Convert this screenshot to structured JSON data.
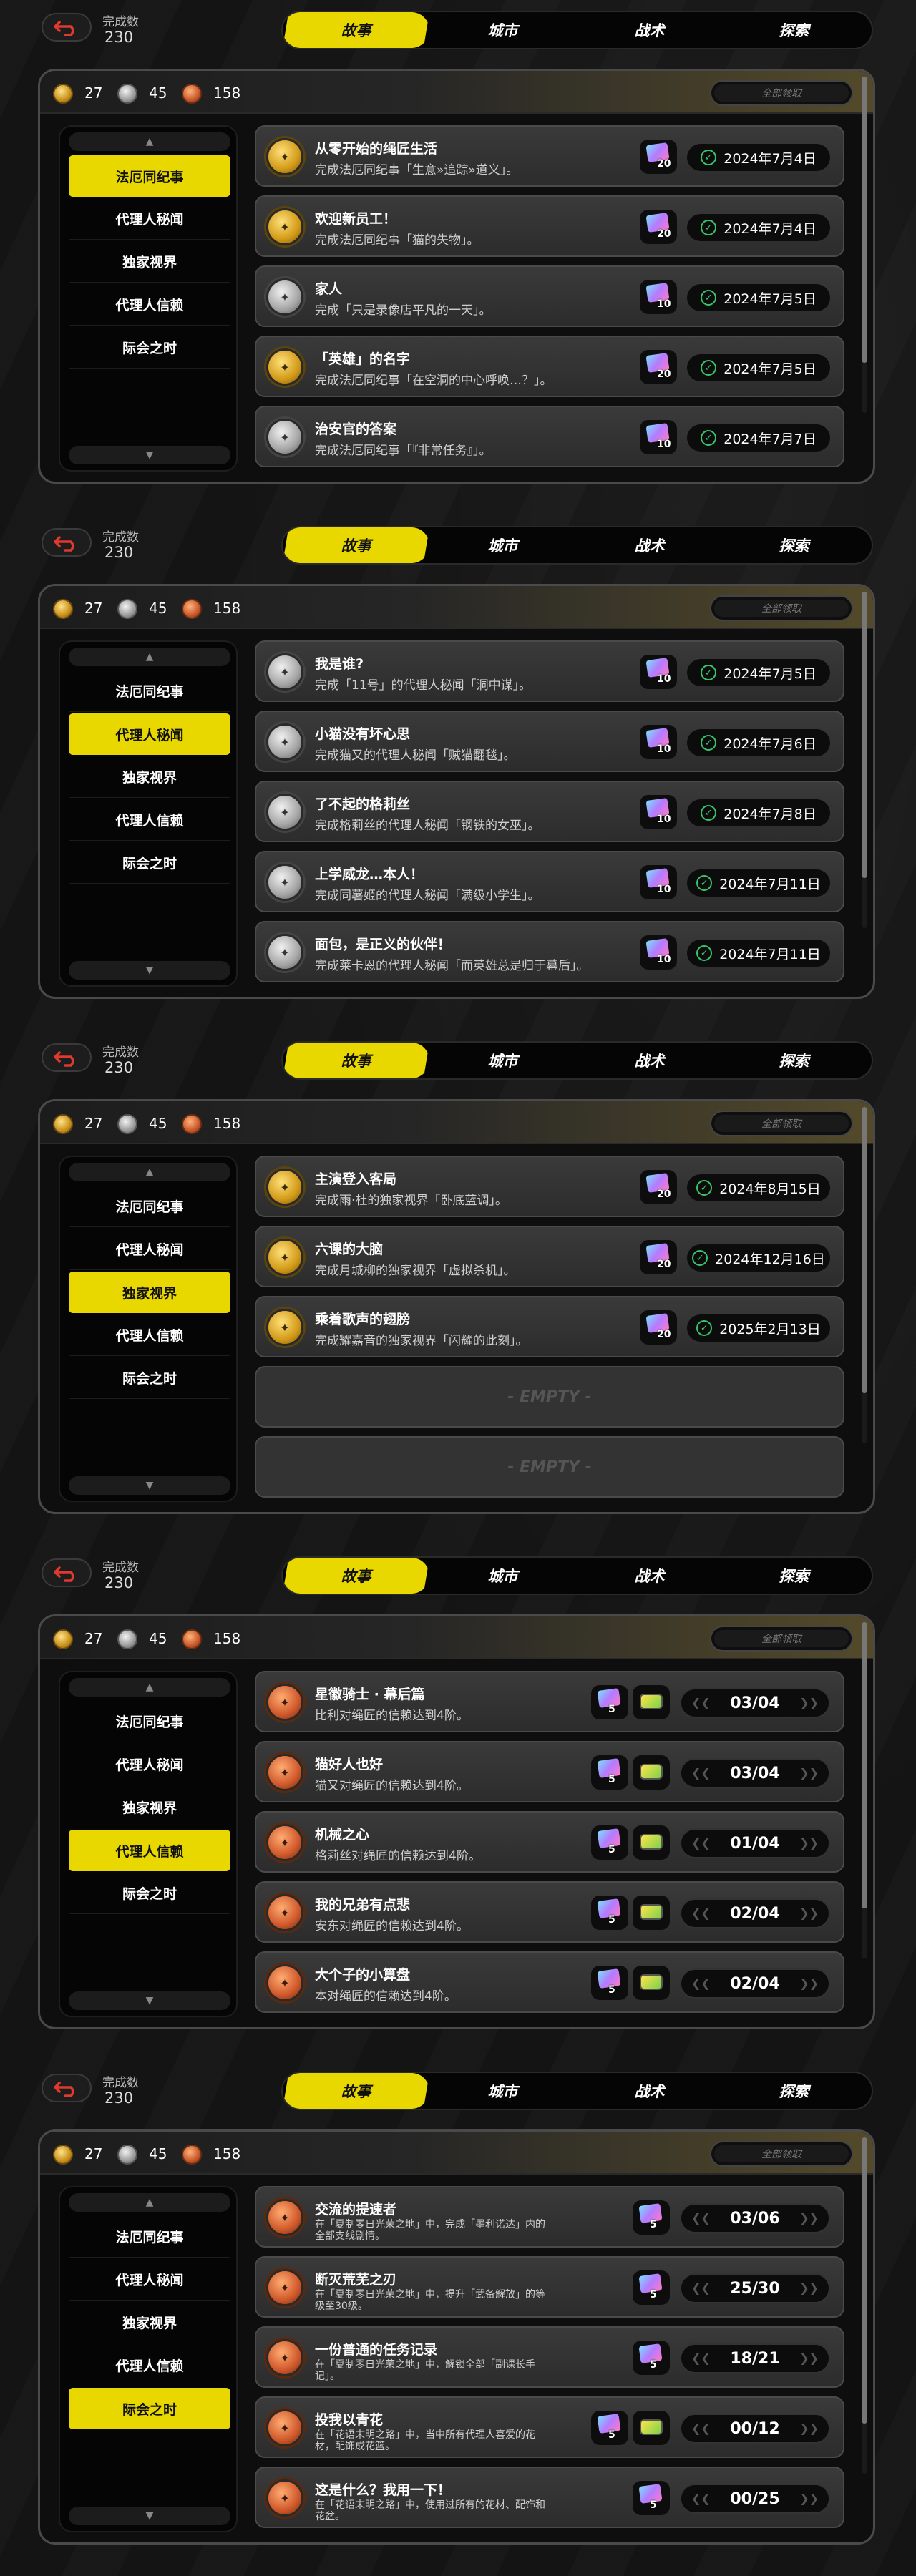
{
  "completion": {
    "label": "完成数",
    "value": "230"
  },
  "tabs": [
    "故事",
    "城市",
    "战术",
    "探索"
  ],
  "currency": {
    "gold": "27",
    "silver": "45",
    "bronze": "158"
  },
  "claim_all": "全部领取",
  "sidebar": [
    "法厄同纪事",
    "代理人秘闻",
    "独家视界",
    "代理人信赖",
    "际会之时"
  ],
  "empty_label": "- EMPTY -",
  "sections": [
    {
      "active_sidebar": 0,
      "items": [
        {
          "medal": "gold",
          "title": "从零开始的绳匠生活",
          "desc": "完成法厄同纪事「生意»追踪»道义」。",
          "reward": "20",
          "status": "date",
          "date": "2024年7月4日"
        },
        {
          "medal": "gold",
          "title": "欢迎新员工！",
          "desc": "完成法厄同纪事「猫的失物」。",
          "reward": "20",
          "status": "date",
          "date": "2024年7月4日"
        },
        {
          "medal": "silver",
          "title": "家人",
          "desc": "完成「只是录像店平凡的一天」。",
          "reward": "10",
          "status": "date",
          "date": "2024年7月5日"
        },
        {
          "medal": "gold",
          "title": "「英雄」的名字",
          "desc": "完成法厄同纪事「在空洞的中心呼唤…？」。",
          "reward": "20",
          "status": "date",
          "date": "2024年7月5日"
        },
        {
          "medal": "silver",
          "title": "治安官的答案",
          "desc": "完成法厄同纪事「『非常任务』」。",
          "reward": "10",
          "status": "date",
          "date": "2024年7月7日"
        }
      ]
    },
    {
      "active_sidebar": 1,
      "items": [
        {
          "medal": "silver",
          "title": "我是谁?",
          "desc": "完成「11号」的代理人秘闻「洞中谋」。",
          "reward": "10",
          "status": "date",
          "date": "2024年7月5日"
        },
        {
          "medal": "silver",
          "title": "小猫没有坏心思",
          "desc": "完成猫又的代理人秘闻「贼猫翻毯」。",
          "reward": "10",
          "status": "date",
          "date": "2024年7月6日"
        },
        {
          "medal": "silver",
          "title": "了不起的格莉丝",
          "desc": "完成格莉丝的代理人秘闻「钢铁的女巫」。",
          "reward": "10",
          "status": "date",
          "date": "2024年7月8日"
        },
        {
          "medal": "silver",
          "title": "上学威龙…本人！",
          "desc": "完成同薯姬的代理人秘闻「满级小学生」。",
          "reward": "10",
          "status": "date",
          "date": "2024年7月11日"
        },
        {
          "medal": "silver",
          "title": "面包，是正义的伙伴！",
          "desc": "完成莱卡恩的代理人秘闻「而英雄总是归于幕后」。",
          "reward": "10",
          "status": "date",
          "date": "2024年7月11日"
        }
      ]
    },
    {
      "active_sidebar": 2,
      "items": [
        {
          "medal": "gold",
          "title": "主演登入客局",
          "desc": "完成雨·杜的独家视界「卧底蓝调」。",
          "reward": "20",
          "status": "date",
          "date": "2024年8月15日"
        },
        {
          "medal": "gold",
          "title": "六课的大脑",
          "desc": "完成月城柳的独家视界「虚拟杀机」。",
          "reward": "20",
          "status": "date",
          "date": "2024年12月16日"
        },
        {
          "medal": "gold",
          "title": "乘着歌声的翅膀",
          "desc": "完成耀嘉音的独家视界「闪耀的此刻」。",
          "reward": "20",
          "status": "date",
          "date": "2025年2月13日"
        },
        {
          "empty": true
        },
        {
          "empty": true
        }
      ]
    },
    {
      "active_sidebar": 3,
      "items": [
        {
          "medal": "bronze",
          "title": "星徽骑士 · 幕后篇",
          "desc": "比利对绳匠的信赖达到4阶。",
          "reward": "5",
          "extra": true,
          "status": "progress",
          "progress": "03/04"
        },
        {
          "medal": "bronze",
          "title": "猫好人也好",
          "desc": "猫又对绳匠的信赖达到4阶。",
          "reward": "5",
          "extra": true,
          "status": "progress",
          "progress": "03/04"
        },
        {
          "medal": "bronze",
          "title": "机械之心",
          "desc": "格莉丝对绳匠的信赖达到4阶。",
          "reward": "5",
          "extra": true,
          "status": "progress",
          "progress": "01/04"
        },
        {
          "medal": "bronze",
          "title": "我的兄弟有点悲",
          "desc": "安东对绳匠的信赖达到4阶。",
          "reward": "5",
          "extra": true,
          "status": "progress",
          "progress": "02/04"
        },
        {
          "medal": "bronze",
          "title": "大个子的小算盘",
          "desc": "本对绳匠的信赖达到4阶。",
          "reward": "5",
          "extra": true,
          "status": "progress",
          "progress": "02/04"
        }
      ]
    },
    {
      "active_sidebar": 4,
      "items": [
        {
          "medal": "bronze",
          "title": "交流的提速者",
          "desc": "在「夏制零日光荣之地」中，完成「墨利诺达」内的全部支线剧情。",
          "small": true,
          "reward": "5",
          "status": "progress",
          "progress": "03/06"
        },
        {
          "medal": "bronze",
          "title": "断灭荒芜之刃",
          "desc": "在「夏制零日光荣之地」中，提升「武备解放」的等级至30级。",
          "small": true,
          "reward": "5",
          "status": "progress",
          "progress": "25/30"
        },
        {
          "medal": "bronze",
          "title": "一份普通的任务记录",
          "desc": "在「夏制零日光荣之地」中，解锁全部「副课长手记」。",
          "small": true,
          "reward": "5",
          "status": "progress",
          "progress": "18/21"
        },
        {
          "medal": "bronze",
          "title": "投我以青花",
          "desc": "在「花语末明之路」中，当中所有代理人喜爱的花材，配饰成花篮。",
          "small": true,
          "reward": "5",
          "extra": true,
          "status": "progress",
          "progress": "00/12"
        },
        {
          "medal": "bronze",
          "title": "这是什么？我用一下！",
          "desc": "在「花语末明之路」中，使用过所有的花材、配饰和花盆。",
          "small": true,
          "reward": "5",
          "status": "progress",
          "progress": "00/25"
        }
      ]
    }
  ]
}
